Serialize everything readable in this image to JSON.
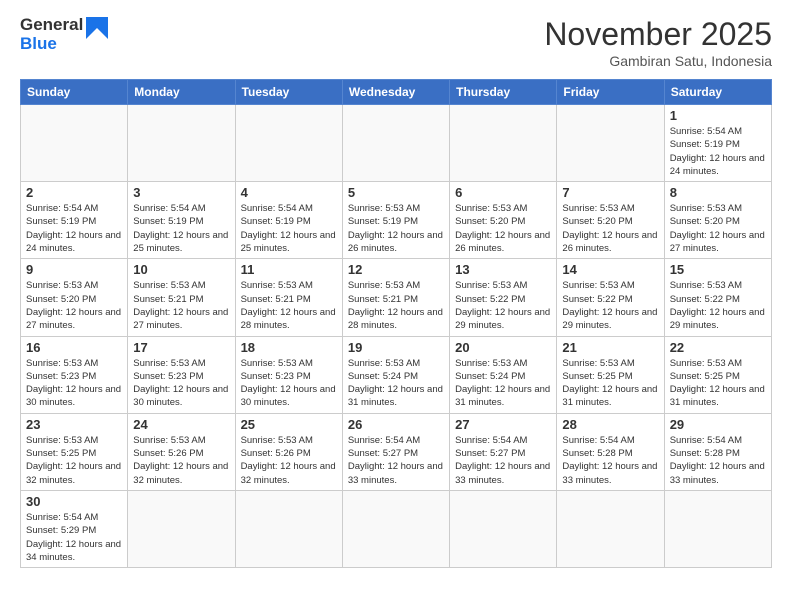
{
  "header": {
    "logo_general": "General",
    "logo_blue": "Blue",
    "month": "November 2025",
    "location": "Gambiran Satu, Indonesia"
  },
  "weekdays": [
    "Sunday",
    "Monday",
    "Tuesday",
    "Wednesday",
    "Thursday",
    "Friday",
    "Saturday"
  ],
  "days": {
    "1": {
      "sunrise": "5:54 AM",
      "sunset": "5:19 PM",
      "daylight": "12 hours and 24 minutes."
    },
    "2": {
      "sunrise": "5:54 AM",
      "sunset": "5:19 PM",
      "daylight": "12 hours and 24 minutes."
    },
    "3": {
      "sunrise": "5:54 AM",
      "sunset": "5:19 PM",
      "daylight": "12 hours and 25 minutes."
    },
    "4": {
      "sunrise": "5:54 AM",
      "sunset": "5:19 PM",
      "daylight": "12 hours and 25 minutes."
    },
    "5": {
      "sunrise": "5:53 AM",
      "sunset": "5:19 PM",
      "daylight": "12 hours and 26 minutes."
    },
    "6": {
      "sunrise": "5:53 AM",
      "sunset": "5:20 PM",
      "daylight": "12 hours and 26 minutes."
    },
    "7": {
      "sunrise": "5:53 AM",
      "sunset": "5:20 PM",
      "daylight": "12 hours and 26 minutes."
    },
    "8": {
      "sunrise": "5:53 AM",
      "sunset": "5:20 PM",
      "daylight": "12 hours and 27 minutes."
    },
    "9": {
      "sunrise": "5:53 AM",
      "sunset": "5:20 PM",
      "daylight": "12 hours and 27 minutes."
    },
    "10": {
      "sunrise": "5:53 AM",
      "sunset": "5:21 PM",
      "daylight": "12 hours and 27 minutes."
    },
    "11": {
      "sunrise": "5:53 AM",
      "sunset": "5:21 PM",
      "daylight": "12 hours and 28 minutes."
    },
    "12": {
      "sunrise": "5:53 AM",
      "sunset": "5:21 PM",
      "daylight": "12 hours and 28 minutes."
    },
    "13": {
      "sunrise": "5:53 AM",
      "sunset": "5:22 PM",
      "daylight": "12 hours and 29 minutes."
    },
    "14": {
      "sunrise": "5:53 AM",
      "sunset": "5:22 PM",
      "daylight": "12 hours and 29 minutes."
    },
    "15": {
      "sunrise": "5:53 AM",
      "sunset": "5:22 PM",
      "daylight": "12 hours and 29 minutes."
    },
    "16": {
      "sunrise": "5:53 AM",
      "sunset": "5:23 PM",
      "daylight": "12 hours and 30 minutes."
    },
    "17": {
      "sunrise": "5:53 AM",
      "sunset": "5:23 PM",
      "daylight": "12 hours and 30 minutes."
    },
    "18": {
      "sunrise": "5:53 AM",
      "sunset": "5:23 PM",
      "daylight": "12 hours and 30 minutes."
    },
    "19": {
      "sunrise": "5:53 AM",
      "sunset": "5:24 PM",
      "daylight": "12 hours and 31 minutes."
    },
    "20": {
      "sunrise": "5:53 AM",
      "sunset": "5:24 PM",
      "daylight": "12 hours and 31 minutes."
    },
    "21": {
      "sunrise": "5:53 AM",
      "sunset": "5:25 PM",
      "daylight": "12 hours and 31 minutes."
    },
    "22": {
      "sunrise": "5:53 AM",
      "sunset": "5:25 PM",
      "daylight": "12 hours and 31 minutes."
    },
    "23": {
      "sunrise": "5:53 AM",
      "sunset": "5:25 PM",
      "daylight": "12 hours and 32 minutes."
    },
    "24": {
      "sunrise": "5:53 AM",
      "sunset": "5:26 PM",
      "daylight": "12 hours and 32 minutes."
    },
    "25": {
      "sunrise": "5:53 AM",
      "sunset": "5:26 PM",
      "daylight": "12 hours and 32 minutes."
    },
    "26": {
      "sunrise": "5:54 AM",
      "sunset": "5:27 PM",
      "daylight": "12 hours and 33 minutes."
    },
    "27": {
      "sunrise": "5:54 AM",
      "sunset": "5:27 PM",
      "daylight": "12 hours and 33 minutes."
    },
    "28": {
      "sunrise": "5:54 AM",
      "sunset": "5:28 PM",
      "daylight": "12 hours and 33 minutes."
    },
    "29": {
      "sunrise": "5:54 AM",
      "sunset": "5:28 PM",
      "daylight": "12 hours and 33 minutes."
    },
    "30": {
      "sunrise": "5:54 AM",
      "sunset": "5:29 PM",
      "daylight": "12 hours and 34 minutes."
    }
  }
}
